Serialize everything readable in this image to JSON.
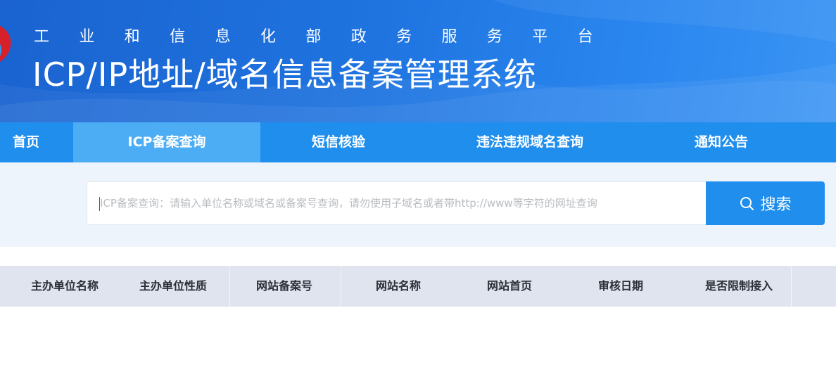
{
  "header": {
    "subtitle_chars": [
      "工",
      "业",
      "和",
      "信",
      "息",
      "化",
      "部",
      "政",
      "务",
      "服",
      "务",
      "平",
      "台"
    ],
    "title": "ICP/IP地址/域名信息备案管理系统"
  },
  "nav": {
    "items": [
      {
        "label": "首页",
        "active": false
      },
      {
        "label": "ICP备案查询",
        "active": true
      },
      {
        "label": "短信核验",
        "active": false
      },
      {
        "label": "违法违规域名查询",
        "active": false
      },
      {
        "label": "通知公告",
        "active": false
      }
    ]
  },
  "search": {
    "placeholder": "ICP备案查询：请输入单位名称或域名或备案号查询，请勿使用子域名或者带http://www等字符的网址查询",
    "button_label": "搜索",
    "value": ""
  },
  "table": {
    "columns": [
      "主办单位名称",
      "主办单位性质",
      "网站备案号",
      "网站名称",
      "网站首页",
      "审核日期",
      "是否限制接入"
    ]
  },
  "colors": {
    "header": "#1f74e0",
    "nav": "#1f8eed",
    "nav_active": "#4cadf4",
    "search_band": "#eef4fb",
    "table_head": "#dfe4ee"
  }
}
